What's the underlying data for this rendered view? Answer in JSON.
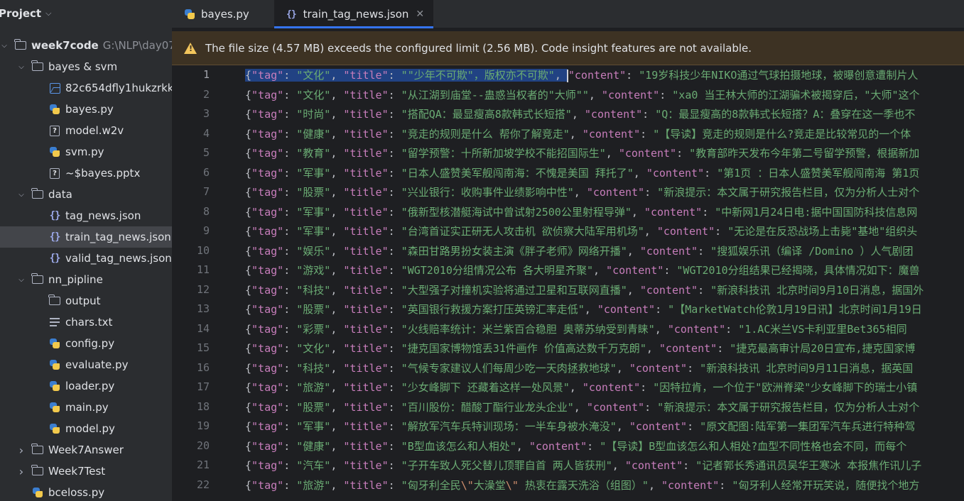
{
  "project": {
    "title": "Project"
  },
  "tree": [
    {
      "indent": 0,
      "expanded": true,
      "icon": "folder",
      "label": "week7code",
      "bold": true,
      "path": "G:\\NLP\\day07\\"
    },
    {
      "indent": 1,
      "expanded": true,
      "icon": "folder",
      "label": "bayes & svm"
    },
    {
      "indent": 2,
      "icon": "image",
      "label": "82c654dfly1hukzrkkk"
    },
    {
      "indent": 2,
      "icon": "python",
      "label": "bayes.py"
    },
    {
      "indent": 2,
      "icon": "unknown",
      "label": "model.w2v"
    },
    {
      "indent": 2,
      "icon": "python",
      "label": "svm.py"
    },
    {
      "indent": 2,
      "icon": "unknown",
      "label": "~$bayes.pptx"
    },
    {
      "indent": 1,
      "expanded": true,
      "icon": "folder",
      "label": "data"
    },
    {
      "indent": 2,
      "icon": "json",
      "label": "tag_news.json"
    },
    {
      "indent": 2,
      "icon": "json",
      "label": "train_tag_news.json",
      "selected": true
    },
    {
      "indent": 2,
      "icon": "json",
      "label": "valid_tag_news.json"
    },
    {
      "indent": 1,
      "expanded": true,
      "icon": "folder",
      "label": "nn_pipline"
    },
    {
      "indent": 2,
      "icon": "folder",
      "label": "output"
    },
    {
      "indent": 2,
      "icon": "text",
      "label": "chars.txt"
    },
    {
      "indent": 2,
      "icon": "python",
      "label": "config.py"
    },
    {
      "indent": 2,
      "icon": "python",
      "label": "evaluate.py"
    },
    {
      "indent": 2,
      "icon": "python",
      "label": "loader.py"
    },
    {
      "indent": 2,
      "icon": "python",
      "label": "main.py"
    },
    {
      "indent": 2,
      "icon": "python",
      "label": "model.py"
    },
    {
      "indent": 1,
      "expanded": false,
      "icon": "folder",
      "label": "Week7Answer"
    },
    {
      "indent": 1,
      "expanded": false,
      "icon": "folder",
      "label": "Week7Test"
    },
    {
      "indent": 1,
      "icon": "python",
      "label": "bceloss.py"
    }
  ],
  "tabs": [
    {
      "label": "bayes.py",
      "icon": "python",
      "active": false
    },
    {
      "label": "train_tag_news.json",
      "icon": "json",
      "active": true,
      "close": "✕"
    }
  ],
  "banner": {
    "message": "The file size (4.57 MB) exceeds the configured limit (2.56 MB). Code insight features are not available."
  },
  "editor": {
    "current_line": 1,
    "lines": [
      {
        "n": "1",
        "tag": "文化",
        "title": "\"少年不可欺\"，版权亦不可欺",
        "content": "19岁科技少年NIKO通过气球拍摄地球，被曝创意遭制片人"
      },
      {
        "n": "2",
        "tag": "文化",
        "title": "从江湖到庙堂--蛊惑当权者的\"大师\"",
        "content": "xa0 当王林大师的江湖骗术被揭穿后，\"大师\"这个"
      },
      {
        "n": "3",
        "tag": "时尚",
        "title": "搭配QA：最显瘦高8款韩式长短搭",
        "content": "Q：最显瘦高的8款韩式长短搭？A：叠穿在这一季也不"
      },
      {
        "n": "4",
        "tag": "健康",
        "title": "竞走的规则是什么 帮你了解竞走",
        "content": "【导读】竞走的规则是什么?竞走是比较常见的一个体"
      },
      {
        "n": "5",
        "tag": "教育",
        "title": "留学预警：十所新加坡学校不能招国际生",
        "content": "教育部昨天发布今年第二号留学预警，根据新加"
      },
      {
        "n": "6",
        "tag": "军事",
        "title": "日本人盛赞美军舰闯南海：不愧是美国 拜托了",
        "content": "第1页 ：日本人盛赞美军舰闯南海 第1页"
      },
      {
        "n": "7",
        "tag": "股票",
        "title": "兴业银行：收购事件业绩影响中性",
        "content": "新浪提示：本文属于研究报告栏目，仅为分析人士对个"
      },
      {
        "n": "8",
        "tag": "军事",
        "title": "俄新型核潜艇海试中曾试射2500公里射程导弹",
        "content": "中新网1月24日电:据中国国防科技信息网"
      },
      {
        "n": "9",
        "tag": "军事",
        "title": "台湾首证实正研无人攻击机 欲侦察大陆军用机场",
        "content": "无论是在反恐战场上击毙\"基地\"组织头"
      },
      {
        "n": "10",
        "tag": "娱乐",
        "title": "森田甘路男扮女装主演《胖子老师》网络开播",
        "content": "搜狐娱乐讯（编译 /Domino ）人气剧团"
      },
      {
        "n": "11",
        "tag": "游戏",
        "title": "WGT2010分组情况公布 各大明星齐聚",
        "content": "WGT2010分组结果已经揭晓，具体情况如下：魔兽"
      },
      {
        "n": "12",
        "tag": "科技",
        "title": "大型强子对撞机实验将通过卫星和互联网直播",
        "content": "新浪科技讯 北京时间9月10日消息，据国外"
      },
      {
        "n": "13",
        "tag": "股票",
        "title": "英国银行救援方案打压英镑汇率走低",
        "content": "【MarketWatch伦敦1月19日讯】北京时间1月19日"
      },
      {
        "n": "14",
        "tag": "彩票",
        "title": "火线赔率统计：米兰紫百合稳胆 奥蒂苏纳受到青睐",
        "content": "1.AC米兰VS卡利亚里Bet365相同"
      },
      {
        "n": "15",
        "tag": "文化",
        "title": "捷克国家博物馆丢31件画作 价值高达数千万克朗",
        "content": "捷克最高审计局20日宣布,捷克国家博"
      },
      {
        "n": "16",
        "tag": "科技",
        "title": "气候专家建议人们每周少吃一天肉拯救地球",
        "content": "新浪科技讯 北京时间9月11日消息，据英国"
      },
      {
        "n": "17",
        "tag": "旅游",
        "title": "少女峰脚下 还藏着这样一处风景",
        "content": "因特拉肯，一个位于\"欧洲脊梁\"少女峰脚下的瑞士小镇"
      },
      {
        "n": "18",
        "tag": "股票",
        "title": "百川股份：醋酸丁酯行业龙头企业",
        "content": "新浪提示：本文属于研究报告栏目，仅为分析人士对个"
      },
      {
        "n": "19",
        "tag": "军事",
        "title": "解放军汽车兵特训现场：一半车身被水淹没",
        "content": "原文配图:陆军第一集团军汽车兵进行特种驾"
      },
      {
        "n": "20",
        "tag": "健康",
        "title": "B型血该怎么和人相处",
        "content": "【导读】B型血该怎么和人相处?血型不同性格也会不同，而每个"
      },
      {
        "n": "21",
        "tag": "汽车",
        "title": "子开车致人死父替儿顶罪自首 两人皆获刑",
        "content": "记者郭长秀通讯员吴华王寒冰 本报焦作讯儿子"
      },
      {
        "n": "22",
        "tag": "旅游",
        "title": "匈牙利全民\\\"大澡堂\\\" 热衷在露天洗浴（组图）",
        "content": "匈牙利人经常开玩笑说，随便找个地方"
      }
    ]
  }
}
